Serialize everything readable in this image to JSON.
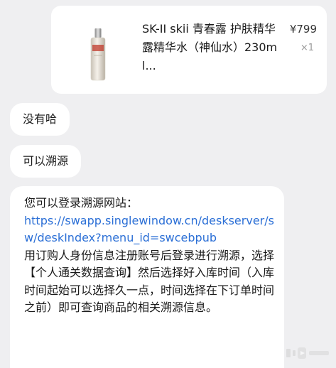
{
  "product": {
    "title": "SK-II skii 青春露 护肤精华露精华水（神仙水）230ml...",
    "price": "¥799",
    "quantity": "×1",
    "image_icon": "product-bottle-image"
  },
  "messages": [
    {
      "text": "没有哈"
    },
    {
      "text": "可以溯源"
    }
  ],
  "long_message": {
    "intro": "您可以登录溯源网站：",
    "link": "https://swapp.singlewindow.cn/deskserver/sw/deskIndex?menu_id=swcebpub",
    "body": "用订购人身份信息注册账号后登录进行溯源，选择【个人通关数据查询】然后选择好入库时间（入库时间起始可以选择久一点，时间选择在下订单时间之前）即可查询商品的相关溯源信息。"
  },
  "colors": {
    "background": "#efeff1",
    "bubble": "#ffffff",
    "link": "#2b6fd6",
    "text": "#1b1b1b"
  }
}
